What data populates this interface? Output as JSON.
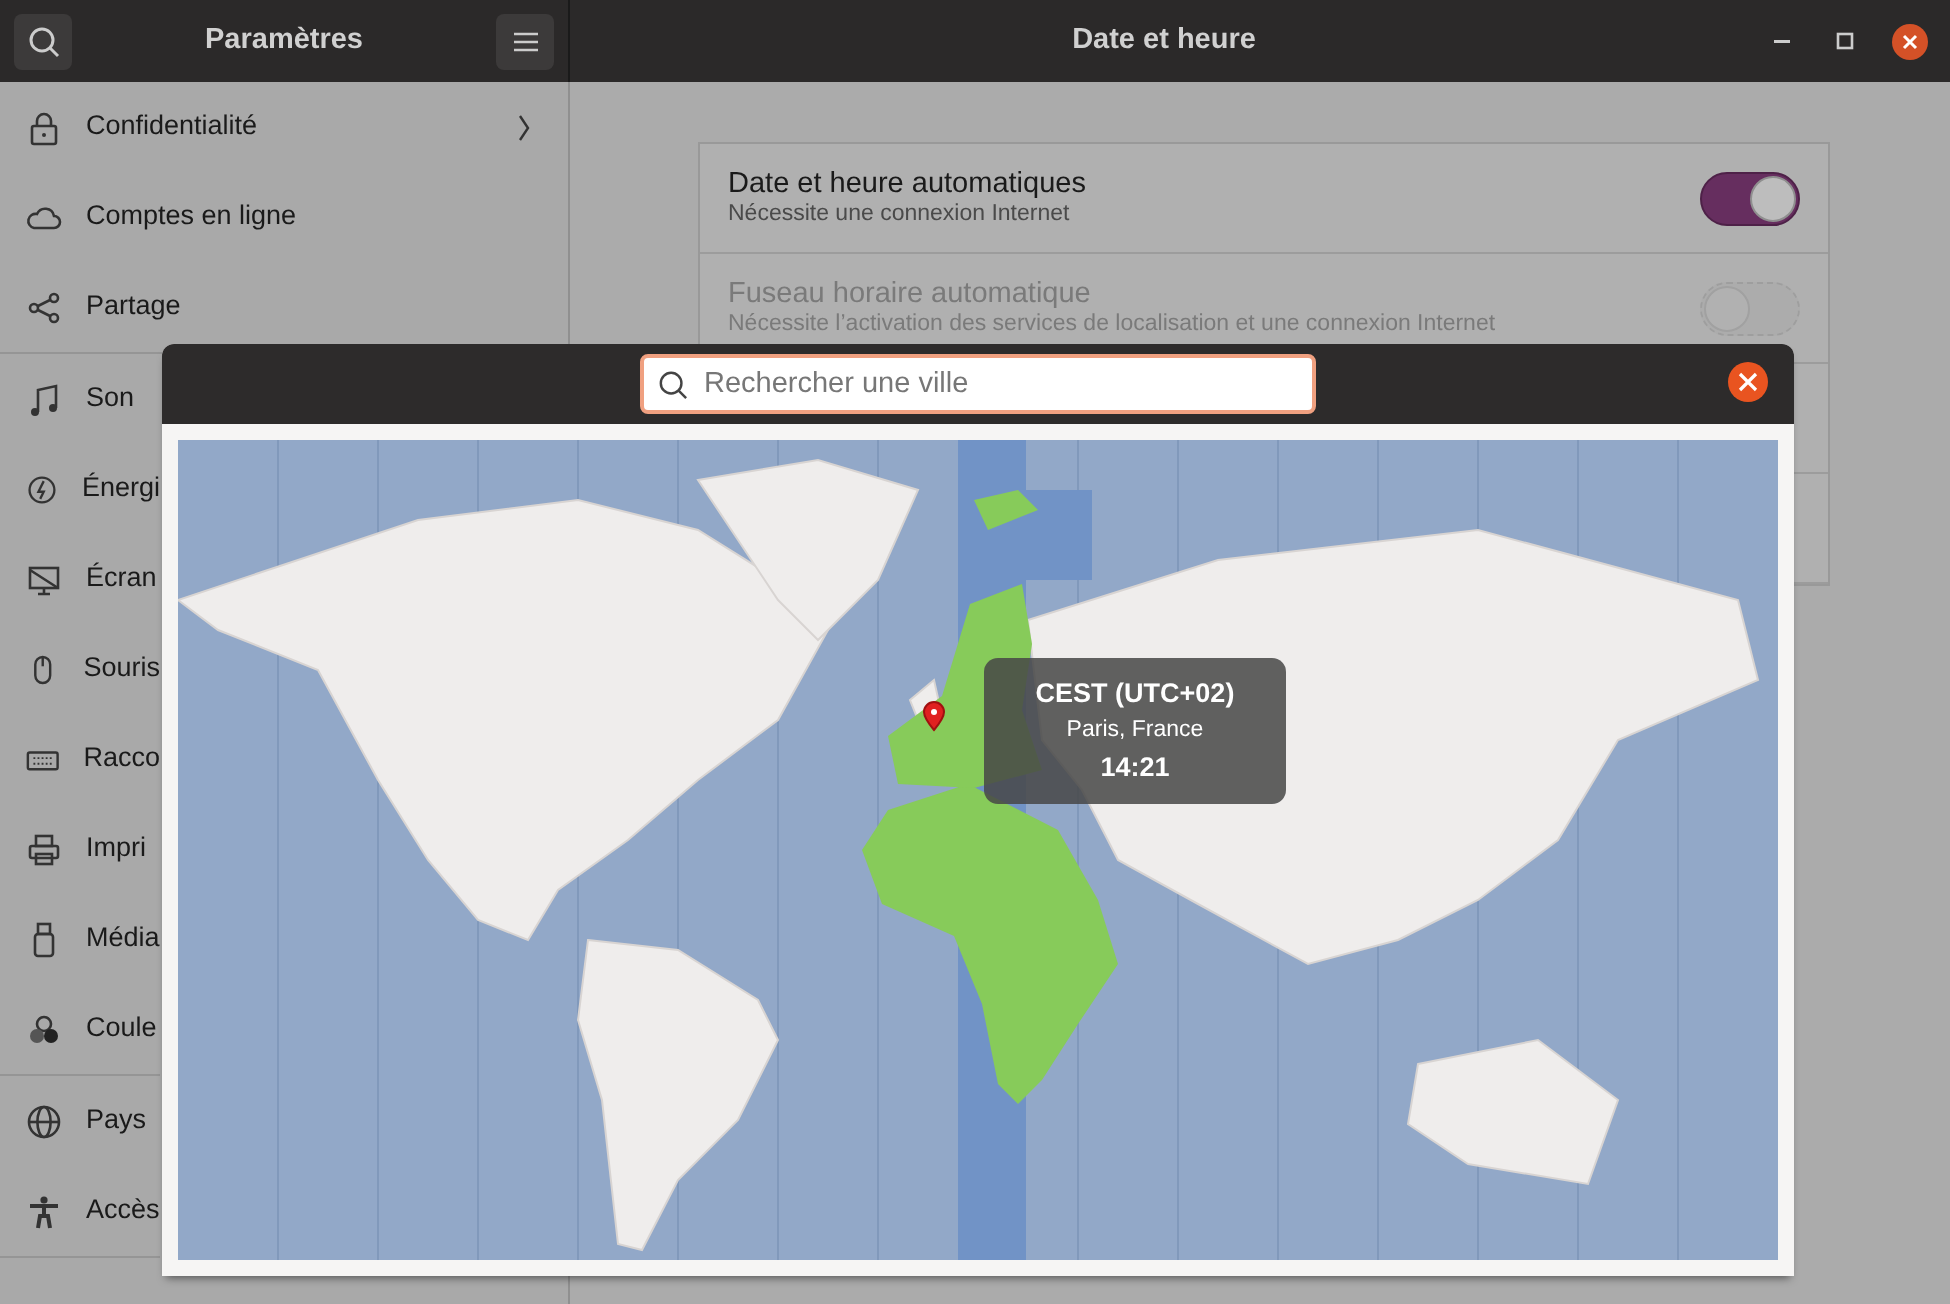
{
  "window": {
    "title": "Paramètres",
    "panel_title": "Date et heure"
  },
  "sidebar": {
    "groups": [
      {
        "items": [
          {
            "label": "Confidentialité",
            "kind": "submenu"
          },
          {
            "label": "Comptes en ligne",
            "kind": "page"
          },
          {
            "label": "Partage",
            "kind": "page"
          }
        ]
      },
      {
        "items": [
          {
            "label": "Son",
            "kind": "page"
          },
          {
            "label": "Énergi",
            "kind": "page"
          },
          {
            "label": "Écran",
            "kind": "page"
          },
          {
            "label": "Souris",
            "kind": "page"
          },
          {
            "label": "Racco",
            "kind": "page"
          },
          {
            "label": "Impri",
            "kind": "page"
          },
          {
            "label": "Média",
            "kind": "page"
          },
          {
            "label": "Coule",
            "kind": "page"
          }
        ]
      },
      {
        "items": [
          {
            "label": "Pays",
            "kind": "page"
          },
          {
            "label": "Accès",
            "kind": "page"
          }
        ]
      }
    ]
  },
  "settings": [
    {
      "title": "Date et heure automatiques",
      "subtitle": "Nécessite une connexion Internet",
      "on": true,
      "disabled": false
    },
    {
      "title": "Fuseau horaire automatique",
      "subtitle": "Nécessite l’activation des services de localisation et une connexion Internet",
      "on": false,
      "disabled": true
    }
  ],
  "timezone_dialog": {
    "search": {
      "placeholder": "Rechercher une ville"
    },
    "tooltip": {
      "zone": "CEST (UTC+02)",
      "city": "Paris, France",
      "time": "14:21"
    }
  }
}
